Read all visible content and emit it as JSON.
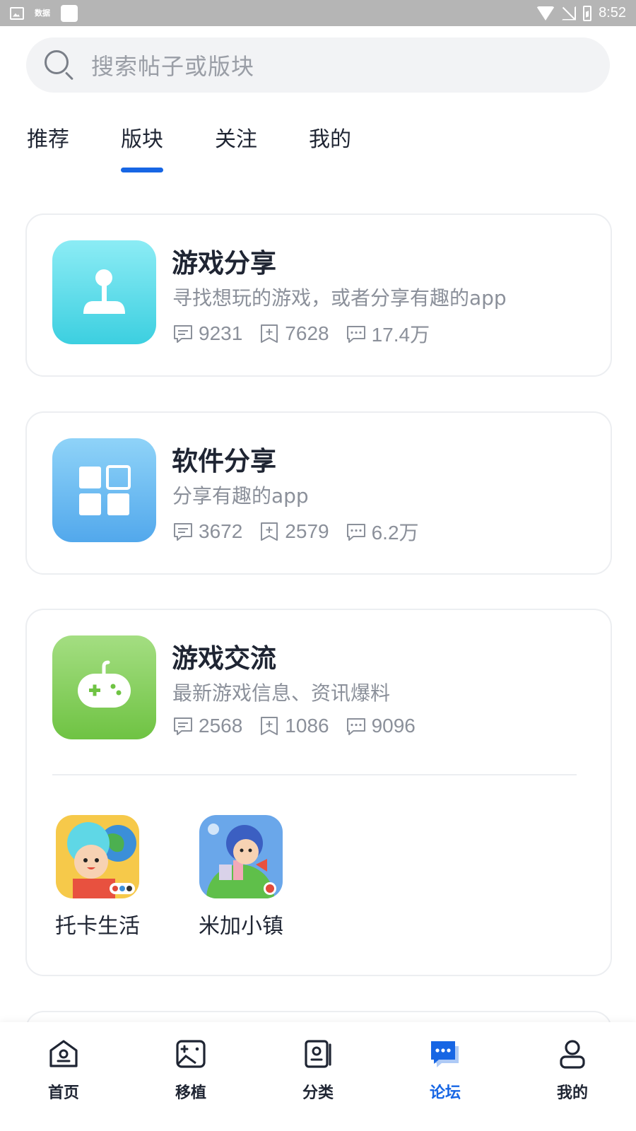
{
  "status_bar": {
    "left_text_icon": "数据",
    "time": "8:52"
  },
  "search": {
    "placeholder": "搜索帖子或版块"
  },
  "tabs": [
    {
      "label": "推荐"
    },
    {
      "label": "版块",
      "active": true
    },
    {
      "label": "关注"
    },
    {
      "label": "我的"
    }
  ],
  "forums": [
    {
      "title": "游戏分享",
      "description": "寻找想玩的游戏，或者分享有趣的app",
      "posts": "9231",
      "follows": "7628",
      "comments": "17.4万",
      "icon": "joystick-icon",
      "color": "#3ccfe0"
    },
    {
      "title": "软件分享",
      "description": "分享有趣的app",
      "posts": "3672",
      "follows": "2579",
      "comments": "6.2万",
      "icon": "apps-grid-icon",
      "color": "#52a8ec"
    },
    {
      "title": "游戏交流",
      "description": "最新游戏信息、资讯爆料",
      "posts": "2568",
      "follows": "1086",
      "comments": "9096",
      "icon": "gamepad-icon",
      "color": "#6fc343",
      "sub_forums": [
        {
          "label": "托卡生活"
        },
        {
          "label": "米加小镇"
        }
      ]
    }
  ],
  "bottom_nav": [
    {
      "label": "首页",
      "icon": "home-icon"
    },
    {
      "label": "移植",
      "icon": "game-port-icon"
    },
    {
      "label": "分类",
      "icon": "category-icon"
    },
    {
      "label": "论坛",
      "icon": "forum-icon",
      "active": true
    },
    {
      "label": "我的",
      "icon": "profile-icon"
    }
  ],
  "colors": {
    "accent": "#1766e4",
    "muted_text": "#8b909a"
  }
}
